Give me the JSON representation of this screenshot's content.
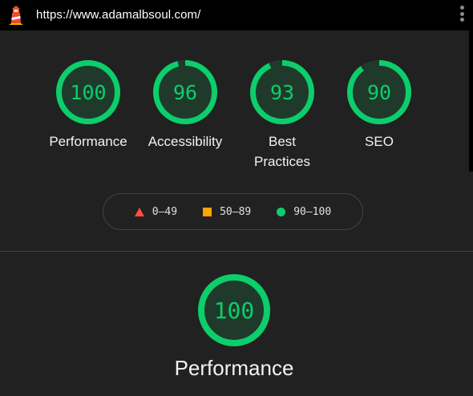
{
  "header": {
    "url": "https://www.adamalbsoul.com/",
    "logo_icon": "lighthouse-icon",
    "menu_icon": "kebab-menu-icon"
  },
  "colors": {
    "pass": "#0cce6b",
    "average": "#ffa400",
    "fail": "#ff4e42",
    "background": "#212121"
  },
  "scores": [
    {
      "label": "Performance",
      "score": "100",
      "fraction": 1.0
    },
    {
      "label": "Accessibility",
      "score": "96",
      "fraction": 0.96
    },
    {
      "label": "Best Practices",
      "score": "93",
      "fraction": 0.93
    },
    {
      "label": "SEO",
      "score": "90",
      "fraction": 0.9
    }
  ],
  "legend": [
    {
      "range": "0–49",
      "shape": "triangle"
    },
    {
      "range": "50–89",
      "shape": "square"
    },
    {
      "range": "90–100",
      "shape": "circle"
    }
  ],
  "section": {
    "title": "Performance",
    "score": "100",
    "fraction": 1.0
  }
}
